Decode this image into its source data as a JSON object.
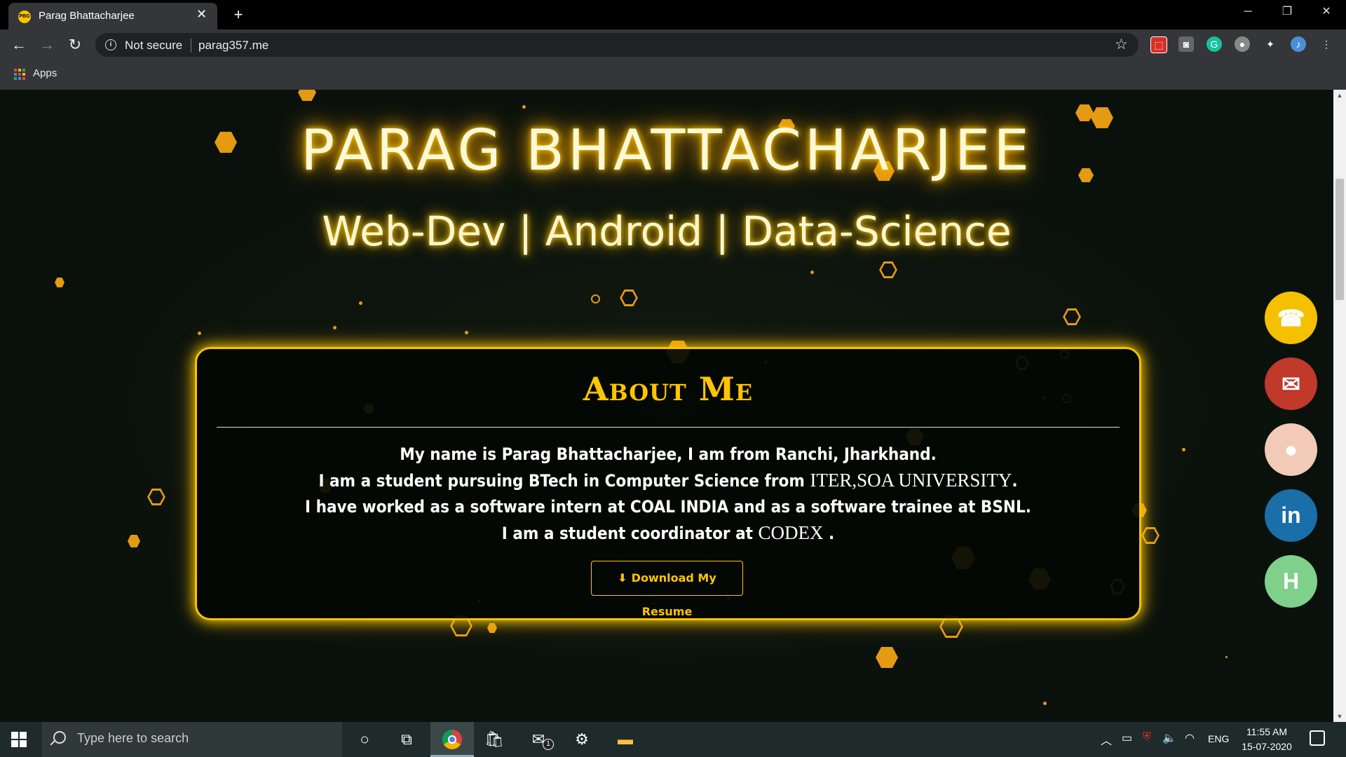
{
  "browser": {
    "tab_title": "Parag Bhattacharjee",
    "tab_favicon_text": "PBG",
    "security_label": "Not secure",
    "url": "parag357.me",
    "bookmarks_apps_label": "Apps"
  },
  "hero": {
    "name": "PARAG BHATTACHARJEE",
    "tagline": "Web-Dev | Android | Data-Science"
  },
  "about": {
    "title": "About Me",
    "line1": "My name is Parag Bhattacharjee, I am from Ranchi, Jharkhand.",
    "line2_prefix": "I am a student pursuing BTech in Computer Science from ",
    "line2_org": "ITER,SOA UNIVERSITY",
    "line2_suffix": ".",
    "line3": "I have worked as a software intern at COAL INDIA and as a software trainee at BSNL.",
    "line4_prefix": "I am a student coordinator at ",
    "line4_org": "CODEX",
    "line4_suffix": " .",
    "resume_button": "Download My Resume"
  },
  "social": [
    {
      "name": "phone",
      "color": "#f5c000",
      "icon_glyph": "☎"
    },
    {
      "name": "email",
      "color": "#c0392b",
      "icon_glyph": "✉"
    },
    {
      "name": "github",
      "color": "#f3c9b7",
      "icon_glyph": "●"
    },
    {
      "name": "linkedin",
      "color": "#1a6fa8",
      "icon_glyph": "in"
    },
    {
      "name": "hackerrank",
      "color": "#7fd08a",
      "icon_glyph": "H"
    }
  ],
  "taskbar": {
    "search_placeholder": "Type here to search",
    "mail_badge": "1",
    "language": "ENG",
    "time": "11:55 AM",
    "date": "15-07-2020"
  },
  "colors": {
    "accent_gold": "#ffc400",
    "hex_orange": "#e49a12",
    "page_bg": "#0d1410"
  }
}
